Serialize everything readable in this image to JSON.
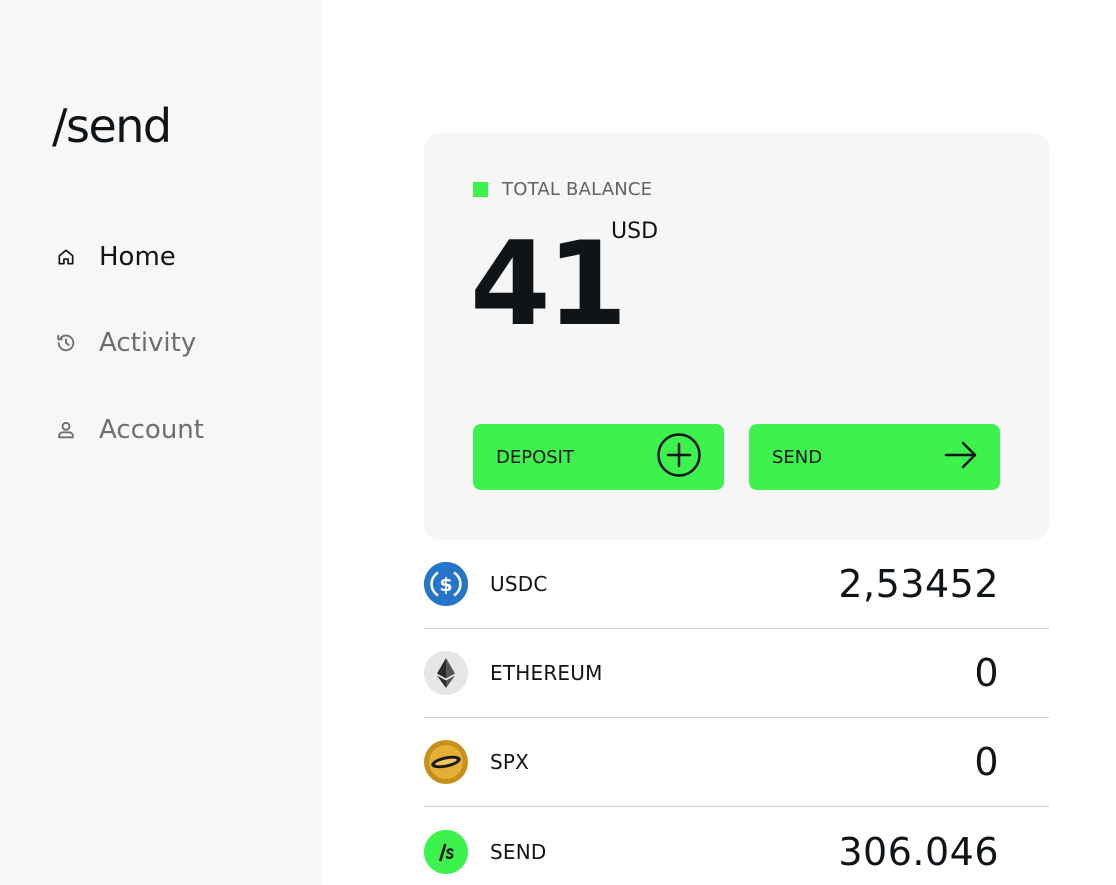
{
  "brand": {
    "logo_text": "/send"
  },
  "nav": {
    "items": [
      {
        "label": "Home",
        "icon": "home-icon",
        "active": true
      },
      {
        "label": "Activity",
        "icon": "history-icon",
        "active": false
      },
      {
        "label": "Account",
        "icon": "user-icon",
        "active": false
      }
    ]
  },
  "balance": {
    "label": "TOTAL BALANCE",
    "amount": "41",
    "currency": "USD",
    "indicator_color": "#3ef24e"
  },
  "actions": {
    "deposit_label": "DEPOSIT",
    "deposit_icon": "plus-circle-icon",
    "send_label": "SEND",
    "send_icon": "arrow-right-icon",
    "button_color": "#3ef24e"
  },
  "tokens": [
    {
      "symbol": "USDC",
      "balance": "2,53452",
      "icon": "usdc-icon",
      "icon_color": "#2775ca"
    },
    {
      "symbol": "ETHEREUM",
      "balance": "0",
      "icon": "ethereum-icon",
      "icon_color": "#e6e6e6"
    },
    {
      "symbol": "SPX",
      "balance": "0",
      "icon": "spx-icon",
      "icon_color": "#d9a324"
    },
    {
      "symbol": "SEND",
      "balance": "306.046",
      "icon": "send-token-icon",
      "icon_color": "#3ef24e"
    }
  ]
}
